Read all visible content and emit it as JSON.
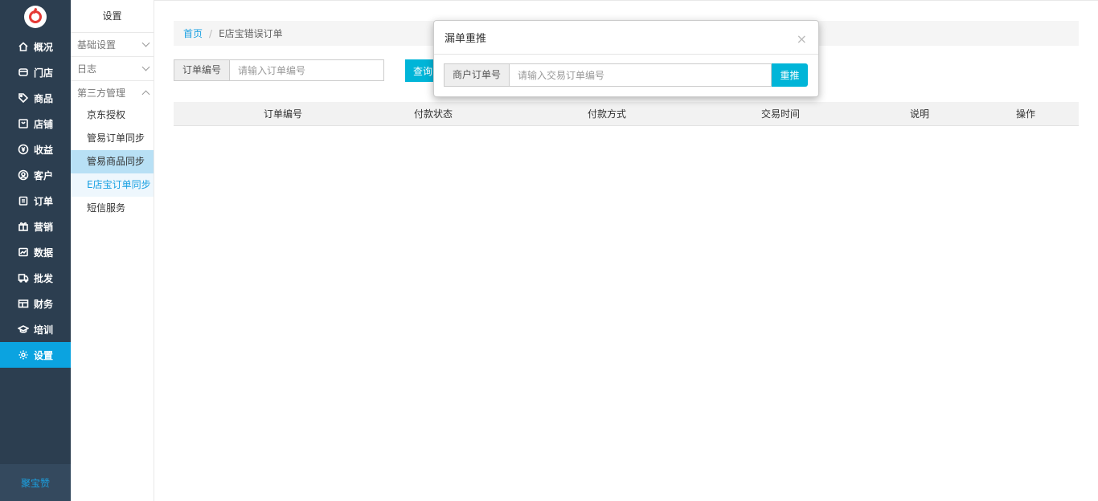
{
  "sidebar": {
    "brand": "聚宝赞",
    "items": [
      {
        "label": "概况",
        "icon": "home-icon"
      },
      {
        "label": "门店",
        "icon": "store-icon"
      },
      {
        "label": "商品",
        "icon": "tag-icon"
      },
      {
        "label": "店铺",
        "icon": "shop-icon"
      },
      {
        "label": "收益",
        "icon": "yuan-icon"
      },
      {
        "label": "客户",
        "icon": "user-icon"
      },
      {
        "label": "订单",
        "icon": "order-icon"
      },
      {
        "label": "营销",
        "icon": "gift-icon"
      },
      {
        "label": "数据",
        "icon": "chart-icon"
      },
      {
        "label": "批发",
        "icon": "truck-icon"
      },
      {
        "label": "财务",
        "icon": "finance-icon"
      },
      {
        "label": "培训",
        "icon": "graduation-icon"
      },
      {
        "label": "设置",
        "icon": "gear-icon"
      }
    ],
    "active_color": "#0ba3e0"
  },
  "submenu": {
    "title": "设置",
    "groups": [
      {
        "label": "基础设置"
      },
      {
        "label": "日志"
      },
      {
        "label": "第三方管理"
      }
    ],
    "items": [
      {
        "label": "京东授权"
      },
      {
        "label": "管易订单同步"
      },
      {
        "label": "管易商品同步"
      },
      {
        "label": "E店宝订单同步"
      },
      {
        "label": "短信服务"
      }
    ]
  },
  "breadcrumb": {
    "home": "首页",
    "separator": "/",
    "current": "E店宝错误订单"
  },
  "search": {
    "label": "订单编号",
    "placeholder": "请输入订单编号",
    "button": "查询"
  },
  "table": {
    "headers": [
      "订单编号",
      "付款状态",
      "付款方式",
      "交易时间",
      "说明",
      "操作"
    ],
    "rows": []
  },
  "modal": {
    "title": "漏单重推",
    "close": "×",
    "label": "商户订单号",
    "placeholder": "请输入交易订单编号",
    "button": "重推"
  },
  "colors": {
    "accent": "#00b5d8",
    "sidebar_bg": "#2c3e50",
    "link": "#1ba1e2"
  }
}
